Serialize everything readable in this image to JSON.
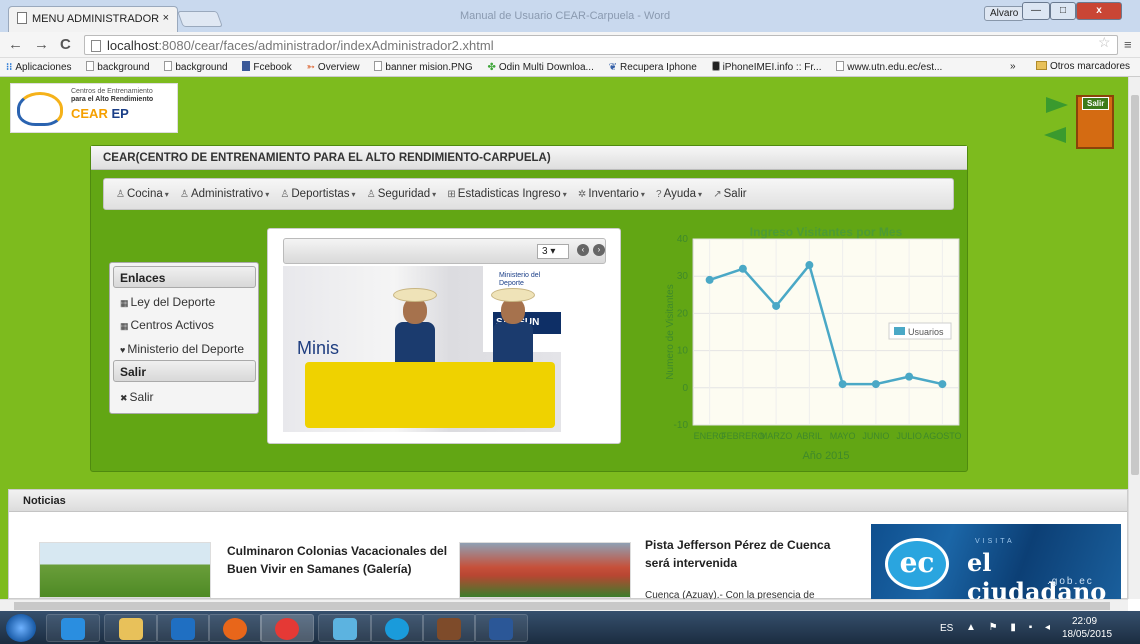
{
  "browser": {
    "tab_title": "MENU ADMINISTRADOR",
    "tab_close": "×",
    "titlebar_text": "Manual de Usuario CEAR-Carpuela - Word",
    "user_badge": "Alvaro",
    "win_min": "—",
    "win_max": "□",
    "win_close": "x",
    "back": "←",
    "forward": "→",
    "reload": "C",
    "url_host": "localhost",
    "url_rest": ":8080/cear/faces/administrador/indexAdministrador2.xhtml",
    "bookmarks": [
      "Aplicaciones",
      "background",
      "background",
      "Fcebook",
      "Overview",
      "banner mision.PNG",
      "Odin Multi Downloa...",
      "Recupera Iphone",
      "iPhoneIMEI.info :: Fr...",
      "www.utn.edu.ec/est..."
    ],
    "bookmarks_more": "»",
    "bookmarks_other": "Otros marcadores"
  },
  "logo": {
    "line1": "Centros de Entrenamiento",
    "line2": "para el Alto Rendimiento",
    "brand_a": "CEAR",
    "brand_b": "EP"
  },
  "exit": {
    "label": "Salir"
  },
  "panel": {
    "title": "CEAR(CENTRO DE ENTRENAMIENTO PARA EL ALTO RENDIMIENTO-CARPUELA)",
    "menu": [
      {
        "icon": "♙",
        "label": "Cocina",
        "caret": "▾"
      },
      {
        "icon": "♙",
        "label": "Administrativo",
        "caret": "▾"
      },
      {
        "icon": "♙",
        "label": "Deportistas",
        "caret": "▾"
      },
      {
        "icon": "♙",
        "label": "Seguridad",
        "caret": "▾"
      },
      {
        "icon": "⊞",
        "label": "Estadisticas Ingreso",
        "caret": "▾"
      },
      {
        "icon": "✲",
        "label": "Inventario",
        "caret": "▾"
      },
      {
        "icon": "?",
        "label": "Ayuda",
        "caret": "▾"
      },
      {
        "icon": "↗",
        "label": "Salir",
        "caret": ""
      }
    ]
  },
  "sidebar": {
    "enlaces_header": "Enlaces",
    "links": [
      {
        "icon": "▦",
        "label": "Ley del Deporte"
      },
      {
        "icon": "▦",
        "label": "Centros Activos"
      },
      {
        "icon": "♥",
        "label": "Ministerio del Deporte"
      }
    ],
    "salir_header": "Salir",
    "salir_link": {
      "icon": "✖",
      "label": "Salir"
    }
  },
  "gallery": {
    "selected_index": "3 ▾",
    "prev": "‹",
    "next": "›",
    "photo_banner_text": "Minis",
    "photo_sign_text": "Ministerio del Deporte",
    "photo_sponsor": "SAMSUN"
  },
  "chart_data": {
    "type": "line",
    "title": "Ingreso Visitantes por Mes",
    "xlabel": "Año 2015",
    "ylabel": "Numero de Visitantes",
    "categories": [
      "ENERO",
      "FEBRERO",
      "MARZO",
      "ABRIL",
      "MAYO",
      "JUNIO",
      "JULIO",
      "AGOSTO"
    ],
    "series": [
      {
        "name": "Usuarios",
        "values": [
          29,
          32,
          22,
          33,
          1,
          1,
          3,
          1
        ]
      }
    ],
    "ylim": [
      -10,
      40
    ],
    "yticks": [
      "-10",
      "0",
      "10",
      "20",
      "30",
      "40"
    ],
    "grid": true,
    "legend": "right",
    "color": "#4aa8c6"
  },
  "news": {
    "header": "Noticias",
    "items": [
      {
        "title": "Culminaron Colonias Vacacionales del Buen Vivir en Samanes (Galería)"
      },
      {
        "title": "Pista Jefferson Pérez de Cuenca será intervenida",
        "snippet": "Cuenca (Azuay).- Con la presencia de"
      }
    ],
    "ad": {
      "visita": "VISITA",
      "ec": "ec",
      "name": "el ciudadano",
      "gob": ".gob.ec"
    }
  },
  "taskbar": {
    "lang": "ES",
    "time": "22:09",
    "date": "18/05/2015"
  }
}
